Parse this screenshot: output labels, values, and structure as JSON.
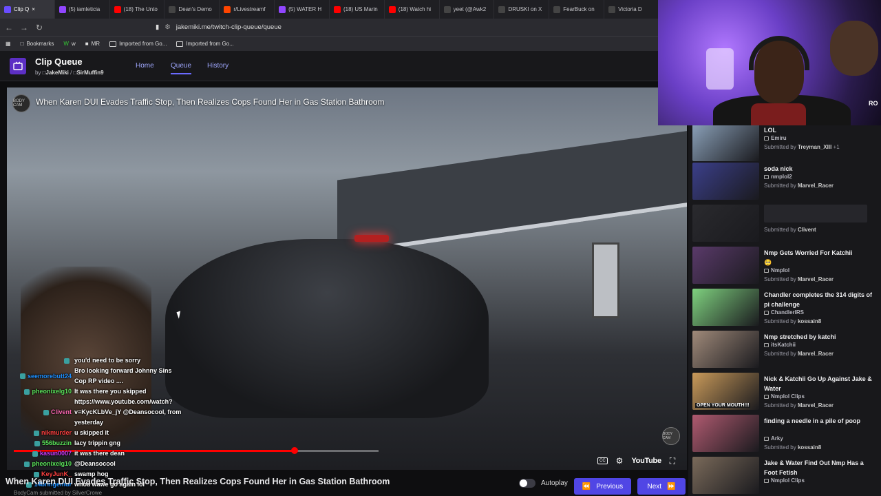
{
  "browser": {
    "tabs": [
      {
        "label": "Clip Q",
        "active": true,
        "icon": "clip-icon",
        "color": "#6a4dff"
      },
      {
        "label": "(5) iamleticia",
        "icon": "twitch-icon",
        "color": "#9146ff"
      },
      {
        "label": "(18) The Unto",
        "icon": "youtube-icon",
        "color": "#ff0000"
      },
      {
        "label": "Dean's Demo",
        "icon": "x-icon",
        "color": "#444444"
      },
      {
        "label": "r/Livestreamf",
        "icon": "reddit-icon",
        "color": "#ff4500"
      },
      {
        "label": "(5) WATER H",
        "icon": "twitch-icon",
        "color": "#9146ff"
      },
      {
        "label": "(18) US Marin",
        "icon": "youtube-icon",
        "color": "#ff0000"
      },
      {
        "label": "(18) Watch hi",
        "icon": "youtube-icon",
        "color": "#ff0000"
      },
      {
        "label": "yeet (@Awk2",
        "icon": "x-icon",
        "color": "#444444"
      },
      {
        "label": "DRUSKI on X",
        "icon": "x-icon",
        "color": "#444444"
      },
      {
        "label": "FearBuck on",
        "icon": "x-icon",
        "color": "#444444"
      },
      {
        "label": "Victoria D",
        "icon": "x-icon",
        "color": "#444444"
      }
    ],
    "url": "jakemiki.me/twitch-clip-queue/queue",
    "bookmarks": [
      "Bookmarks",
      "w",
      "MR",
      "Imported from Go...",
      "Imported from Go..."
    ]
  },
  "app": {
    "title": "Clip Queue",
    "by_prefix": "by",
    "author1": "JakeMiki",
    "separator": "/",
    "author2": "SirMuffin9",
    "nav": [
      "Home",
      "Queue",
      "History"
    ]
  },
  "player": {
    "title": "When Karen DUI Evades Traffic Stop, Then Realizes Cops Found Her in Gas Station Bathroom",
    "channel_badge": "BODY CAM",
    "progress_fraction": 0.77,
    "youtube_label": "YouTube",
    "cc_label": "CC"
  },
  "chat": [
    {
      "user": "",
      "color": "#ffffff",
      "text": "you'd need to be sorry"
    },
    {
      "user": "seemorebutt24",
      "color": "#1e90ff",
      "text": "Bro looking forward Johnny Sins Cop RP video ...."
    },
    {
      "user": "pheonixelg10",
      "color": "#5ce65c",
      "text": "It was there you skipped"
    },
    {
      "user": "Clivent",
      "color": "#ff69b4",
      "text": "https://www.youtube.com/watch?v=KycKLbVe_jY @Deansocool, from yesterday"
    },
    {
      "user": "nikmurder",
      "color": "#ff4040",
      "text": "u skipped it"
    },
    {
      "user": "556buzzin",
      "color": "#5ce65c",
      "text": "lacy trippin gng"
    },
    {
      "user": "kasun0007",
      "color": "#d23cff",
      "text": "it was there dean"
    },
    {
      "user": "pheonixelg10",
      "color": "#5ce65c",
      "text": "@Deansocool"
    },
    {
      "user": "KeyJunK_",
      "color": "#ff4040",
      "text": "swamp hog"
    },
    {
      "user": "14bringemur",
      "color": "#1e90ff",
      "text": "whoa wawe go again lol"
    }
  ],
  "bottom": {
    "title": "When Karen DUI Evades Traffic Stop, Then Realizes Cops Found Her in Gas Station Bathroom",
    "submitted": "BodyCam    submitted by SilverCrowe",
    "autoplay_label": "Autoplay",
    "autoplay_on": false,
    "prev_label": "Previous",
    "next_label": "Next"
  },
  "queue": [
    {
      "title": "LOL",
      "channel": "Emiru",
      "submitted_by": "Treyman_XIII",
      "extra": "+1",
      "thumb": "#8aa0b8"
    },
    {
      "title": "soda nick",
      "channel": "nmplol2",
      "submitted_by": "Marvel_Racer",
      "extra": "",
      "thumb": "#3b3f8a"
    },
    {
      "title": "",
      "channel": "",
      "submitted_by": "Clivent",
      "extra": "",
      "thumb": "#2a2a2e"
    },
    {
      "title": "Nmp Gets Worried For Katchii",
      "emoji": "🥺",
      "channel": "Nmplol",
      "submitted_by": "Marvel_Racer",
      "extra": "",
      "thumb": "#5a3a6a"
    },
    {
      "title": "Chandler completes the 314 digits of pi challenge",
      "channel": "ChandlerIRS",
      "submitted_by": "kossain8",
      "extra": "",
      "thumb": "#7fd17f"
    },
    {
      "title": "Nmp stretched by katchi",
      "channel": "itsKatchii",
      "submitted_by": "Marvel_Racer",
      "extra": "",
      "thumb": "#a08a7a"
    },
    {
      "title": "Nick & Katchii Go Up Against Jake & Water",
      "channel": "Nmplol Clips",
      "submitted_by": "Marvel_Racer",
      "extra": "",
      "thumb": "#c99a5a",
      "thumb_text": "OPEN YOUR MOUTH!!!"
    },
    {
      "title": "finding a needle in a pile of poop",
      "channel": "Arky",
      "submitted_by": "kossain8",
      "extra": "",
      "thumb": "#b05a70"
    },
    {
      "title": "Jake & Water Find Out Nmp Has a Foot Fetish",
      "channel": "Nmplol Clips",
      "submitted_by": "",
      "extra": "",
      "thumb": "#7a6a5a"
    }
  ],
  "queue_submitted_prefix": "Submitted by",
  "webcam": {
    "label": "RO"
  }
}
